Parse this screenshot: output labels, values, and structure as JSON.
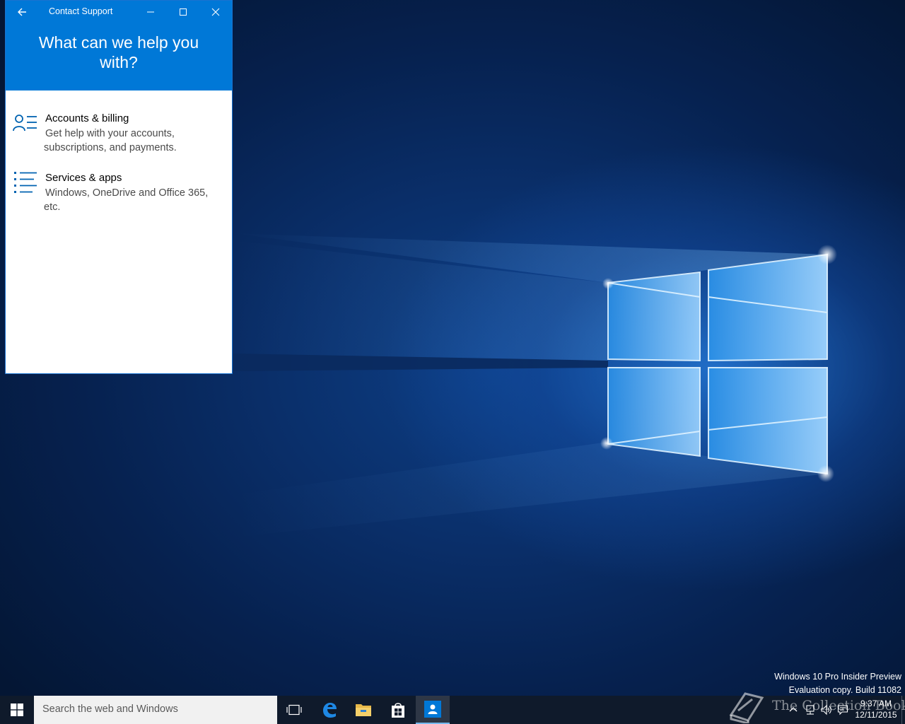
{
  "window": {
    "title": "Contact Support",
    "heading": "What can we help you with?",
    "options": [
      {
        "title": "Accounts & billing",
        "description": "Get help with your accounts, subscriptions, and payments.",
        "icon": "person-list-icon"
      },
      {
        "title": "Services & apps",
        "description": "Windows, OneDrive and Office 365, etc.",
        "icon": "bulleted-list-icon"
      }
    ]
  },
  "desktop": {
    "watermark_line1": "Windows 10 Pro Insider Preview",
    "watermark_line2": "Evaluation copy. Build 11082",
    "site_watermark": "The Collection Book"
  },
  "taskbar": {
    "search_placeholder": "Search the web and Windows",
    "apps": [
      "task-view",
      "edge",
      "file-explorer",
      "store",
      "contact-support"
    ],
    "time": "9:37 AM",
    "date": "12/11/2015"
  },
  "colors": {
    "accent": "#0078d7",
    "taskbar": "#0f1a2b"
  }
}
